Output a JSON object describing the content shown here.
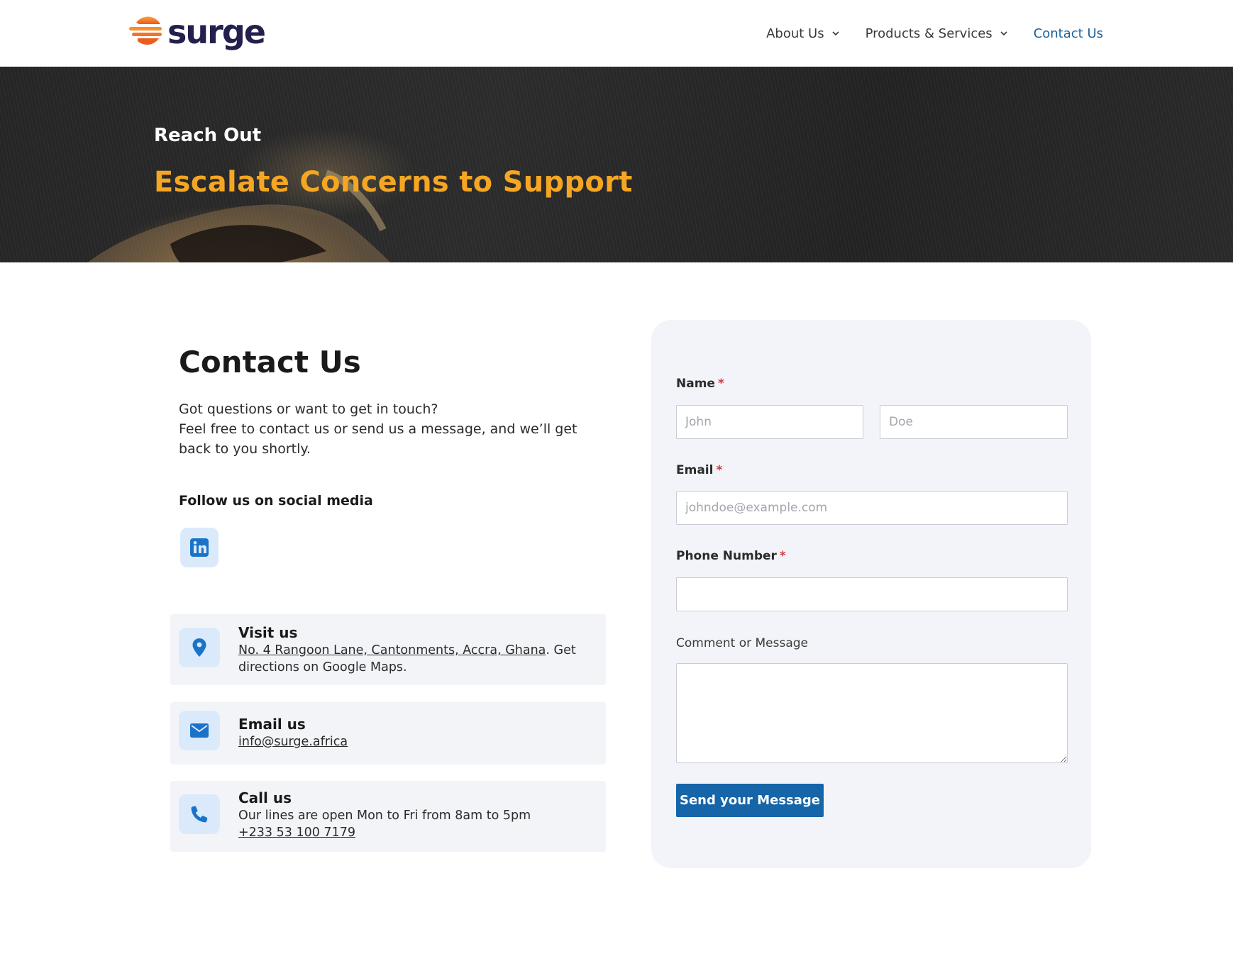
{
  "header": {
    "logo_text": "surge",
    "nav": [
      {
        "label": "About Us",
        "has_dropdown": true,
        "active": false
      },
      {
        "label": "Products & Services",
        "has_dropdown": true,
        "active": false
      },
      {
        "label": "Contact Us",
        "has_dropdown": false,
        "active": true
      }
    ]
  },
  "hero": {
    "kicker": "Reach Out",
    "title": "Escalate Concerns to Support"
  },
  "contact": {
    "title": "Contact Us",
    "intro_line1": "Got questions or want to get in touch?",
    "intro_line2": "Feel free to contact us or send us a message, and we’ll get back to you shortly.",
    "follow_label": "Follow us on social media",
    "social": [
      {
        "name": "linkedin-icon"
      }
    ],
    "cards": {
      "visit": {
        "heading": "Visit us",
        "address": "No. 4 Rangoon Lane, Cantonments, Accra, Ghana",
        "suffix": ". Get directions on Google Maps."
      },
      "email": {
        "heading": "Email us",
        "address": "info@surge.africa"
      },
      "call": {
        "heading": "Call us",
        "hours": "Our lines are open Mon to Fri from 8am to 5pm",
        "phone": "+233 53 100 7179"
      }
    }
  },
  "form": {
    "name_label": "Name",
    "first_placeholder": "John",
    "last_placeholder": "Doe",
    "email_label": "Email",
    "email_placeholder": "johndoe@example.com",
    "phone_label": "Phone Number",
    "phone_value": "",
    "message_label": "Comment or Message",
    "message_value": "",
    "required_mark": "*",
    "submit_label": "Send your Message"
  },
  "colors": {
    "brand_navy": "#23204d",
    "accent_orange": "#f5a623",
    "link_blue": "#1d5f97",
    "button_blue": "#1665a8",
    "icon_blue": "#1a73c9",
    "required_red": "#d63638"
  }
}
